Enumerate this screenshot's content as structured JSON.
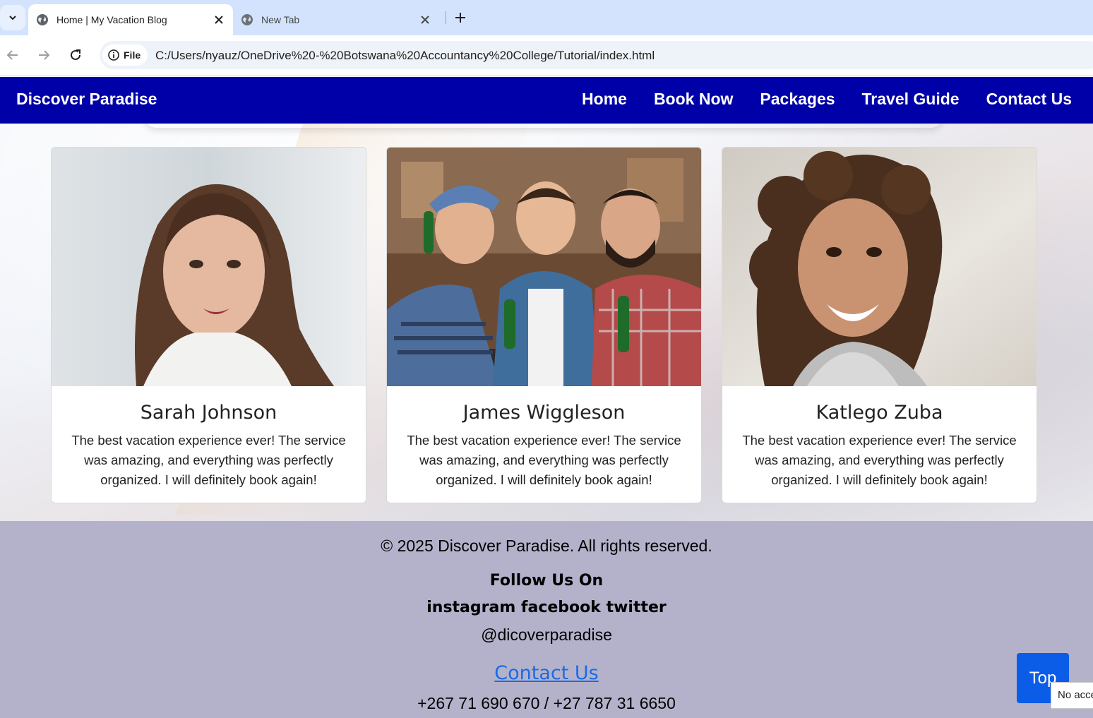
{
  "browser": {
    "tabs": [
      {
        "title": "Home | My Vacation Blog",
        "active": true
      },
      {
        "title": "New Tab",
        "active": false
      }
    ],
    "site_info_label": "File",
    "url": "C:/Users/nyauz/OneDrive%20-%20Botswana%20Accountancy%20College/Tutorial/index.html"
  },
  "site": {
    "brand": "Discover Paradise",
    "nav": [
      "Home",
      "Book Now",
      "Packages",
      "Travel Guide",
      "Contact Us"
    ],
    "colors": {
      "nav_bg": "#0000a8",
      "footer_bg": "#b4b2cb",
      "link": "#1a6be6",
      "top_button": "#0b5ce6"
    }
  },
  "testimonials": [
    {
      "name": "Sarah Johnson",
      "text": "The best vacation experience ever! The service was amazing, and everything was perfectly organized. I will definitely book again!",
      "photo": "woman-portrait-photo"
    },
    {
      "name": "James Wiggleson",
      "text": "The best vacation experience ever! The service was amazing, and everything was perfectly organized. I will definitely book again!",
      "photo": "three-friends-photo"
    },
    {
      "name": "Katlego Zuba",
      "text": "The best vacation experience ever! The service was amazing, and everything was perfectly organized. I will definitely book again!",
      "photo": "smiling-woman-photo"
    }
  ],
  "footer": {
    "copyright": "© 2025 Discover Paradise. All rights reserved.",
    "follow_heading": "Follow Us On",
    "socials": "instagram facebook twitter",
    "handle": "@dicoverparadise",
    "contact_link": "Contact Us",
    "phones": "+267 71 690 670 / +27 787 31 6650"
  },
  "top_button": "Top",
  "tooltip": "No acce"
}
